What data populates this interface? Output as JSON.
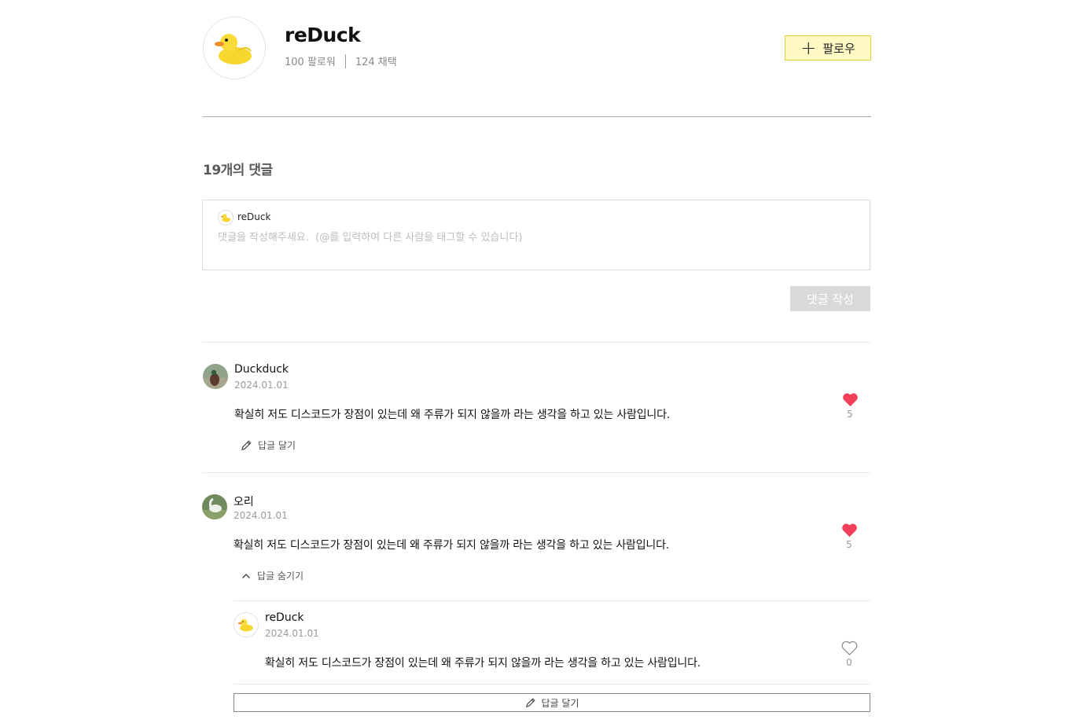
{
  "profile": {
    "name": "reDuck",
    "followers": "100 팔로워",
    "adoptions": "124 채택",
    "follow_label": "팔로우",
    "avatar_icon": "rubber-duck-icon"
  },
  "comments_section": {
    "count_title": "19개의 댓글",
    "editor": {
      "username": "reDuck",
      "placeholder": "댓글을 작성해주세요.  (@를 입력하여 다른 사람을 태그할 수 있습니다)"
    },
    "submit_label": "댓글 작성"
  },
  "comments": [
    {
      "author": "Duckduck",
      "date": "2024.01.01",
      "text": "확실히 저도 디스코드가 장점이 있는데 왜 주류가 되지 않을까 라는 생각을 하고 있는 사람입니다.",
      "likes": "5",
      "liked": true,
      "action_label": "답글 달기"
    },
    {
      "author": "오리",
      "date": "2024.01.01",
      "text": "확실히 저도 디스코드가 장점이 있는데 왜 주류가 되지 않을까 라는 생각을 하고 있는 사람입니다.",
      "likes": "5",
      "liked": true,
      "action_label": "답글 숨기기",
      "replies": [
        {
          "author": "reDuck",
          "date": "2024.01.01",
          "text": "확실히 저도 디스코드가 장점이 있는데 왜 주류가 되지 않을까 라는 생각을 하고 있는 사람입니다.",
          "likes": "0",
          "liked": false
        }
      ],
      "reply_button_label": "답글 달기"
    }
  ],
  "colors": {
    "follow_bg": "#fff9c4",
    "follow_border": "#e2cf3c",
    "heart": "#f2405a",
    "submit_disabled": "#d9d9dc"
  }
}
